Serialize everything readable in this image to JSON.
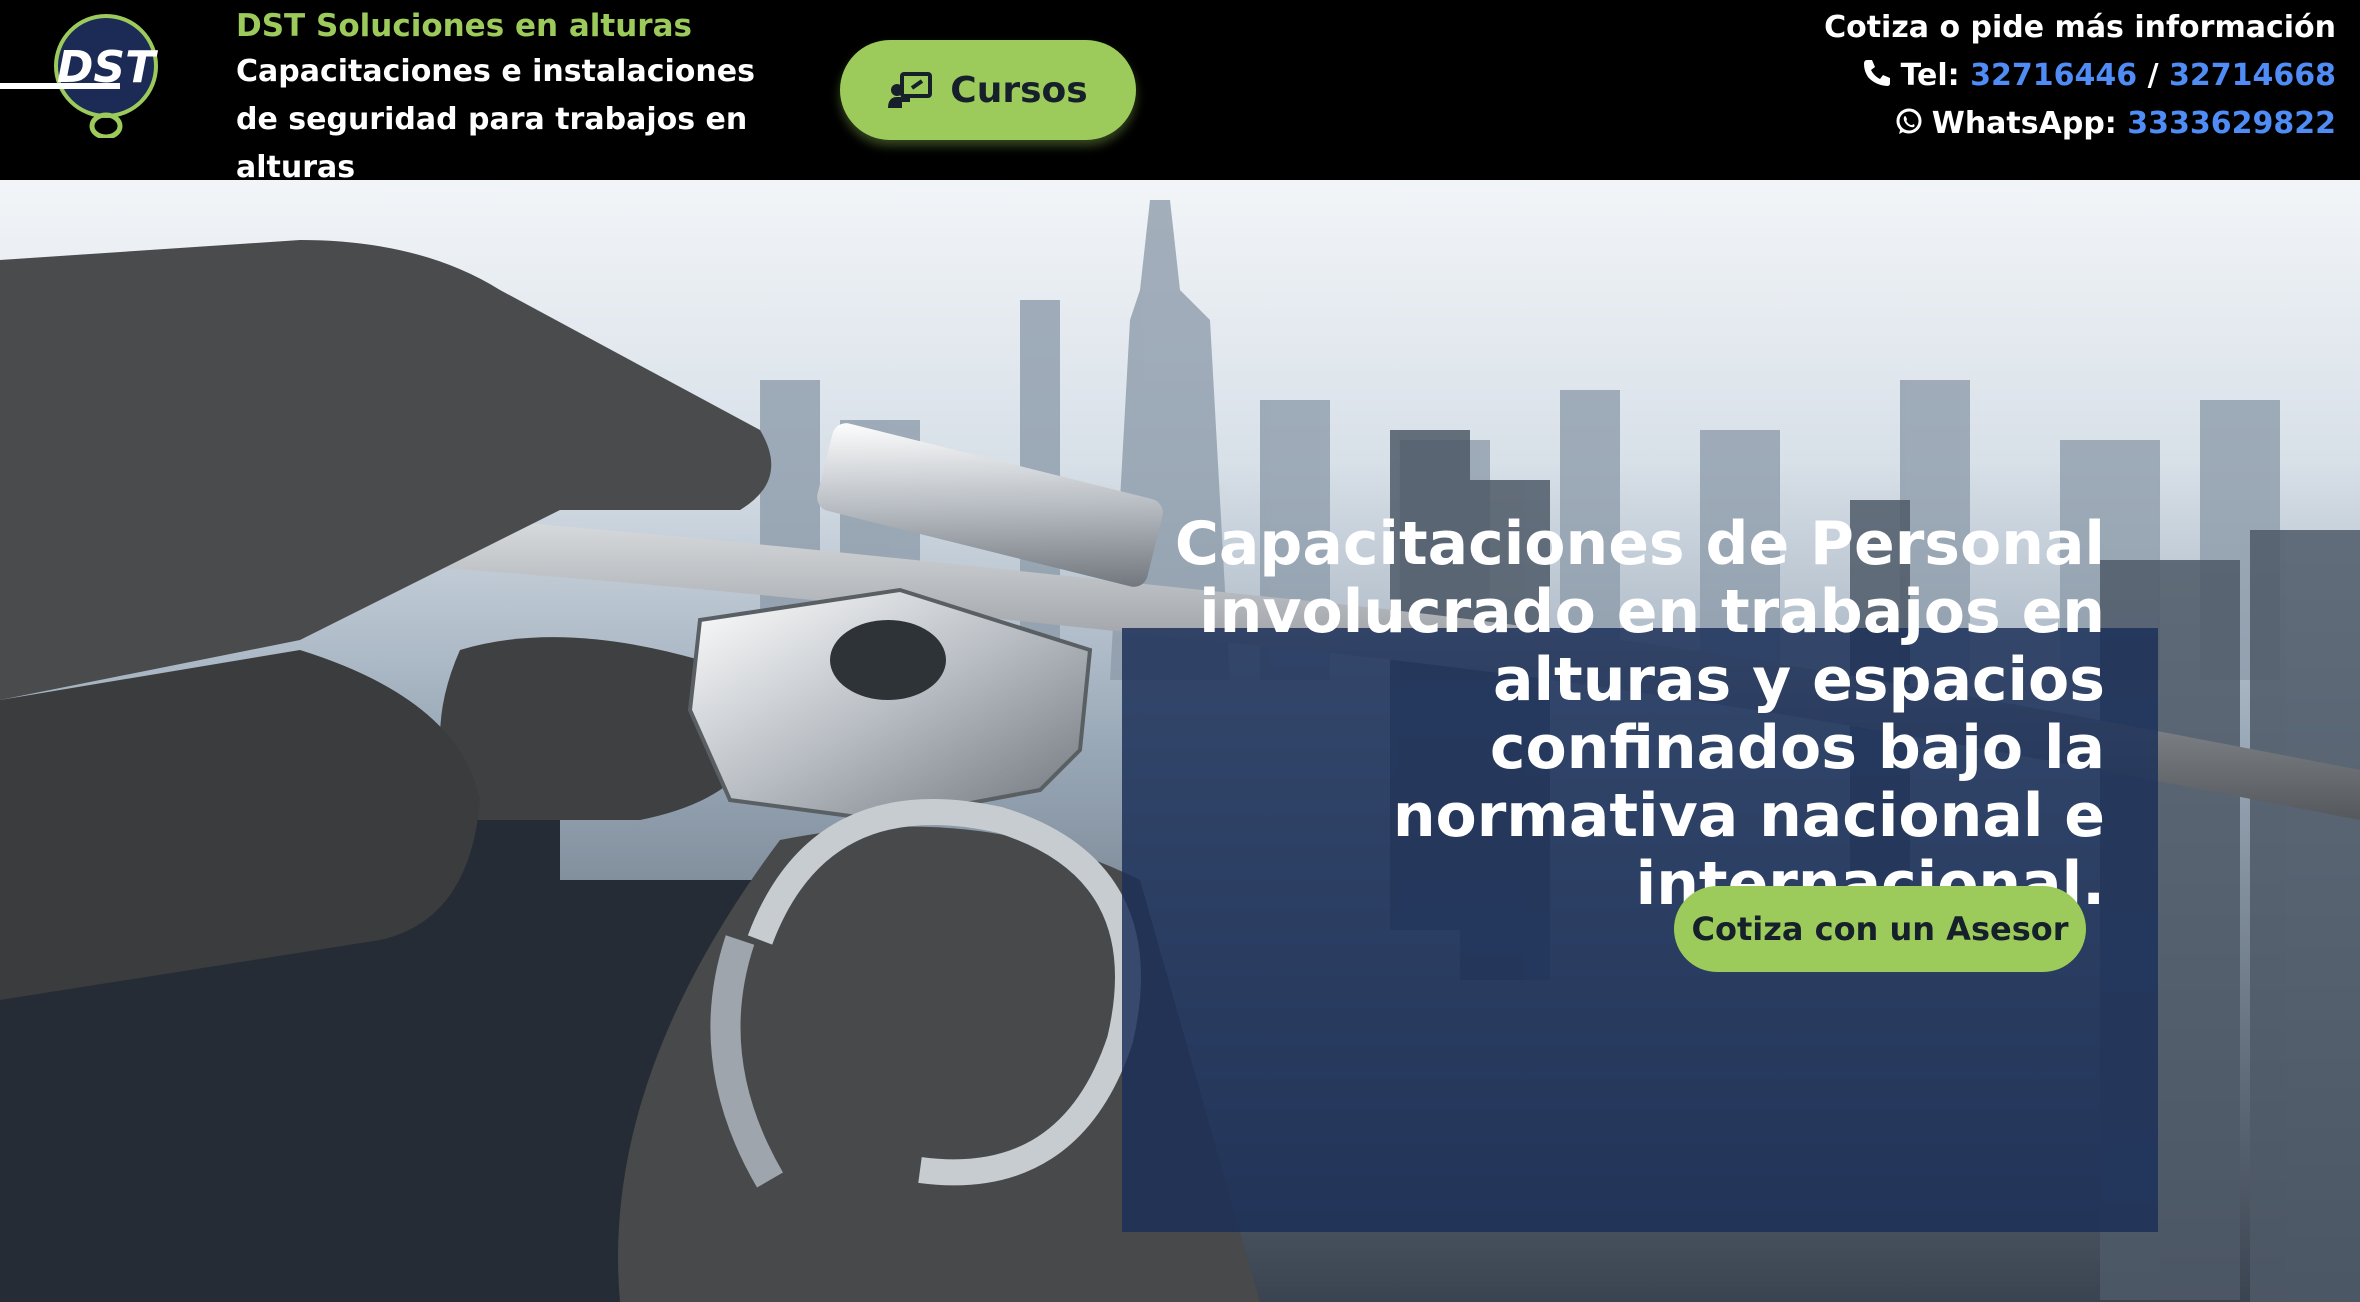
{
  "header": {
    "brand_name": "DST Soluciones en alturas",
    "tagline": "Capacitaciones e instalaciones de seguridad para trabajos en alturas",
    "courses_button": "Cursos",
    "contact_title": "Cotiza o pide más información",
    "tel_label": "Tel:",
    "tel_1": "32716446",
    "tel_separator": "/",
    "tel_2": "32714668",
    "whatsapp_label": "WhatsApp:",
    "whatsapp_number": "3333629822",
    "logo_text": "DST"
  },
  "hero": {
    "headline": "Capacitaciones de Personal involucrado en trabajos en alturas y espacios confinados bajo la normativa nacional e internacional.",
    "cta_button": "Cotiza con un Asesor"
  },
  "colors": {
    "accent_green": "#9ccb5c",
    "link_blue": "#4f8cf5",
    "overlay_navy": "#1c3058"
  },
  "icons": [
    "phone-icon",
    "whatsapp-icon",
    "teacher-icon"
  ]
}
